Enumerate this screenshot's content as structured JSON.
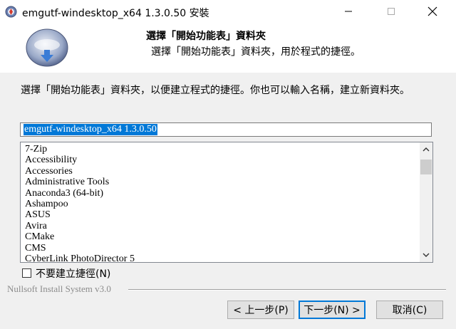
{
  "window": {
    "title": "emgutf-windesktop_x64 1.3.0.50 安裝",
    "controls": {
      "minimize": "—",
      "maximize": "☐",
      "close": "✕"
    }
  },
  "header": {
    "title": "選擇「開始功能表」資料夾",
    "subtitle": "選擇「開始功能表」資料夾，用於程式的捷徑。"
  },
  "instruction": "選擇「開始功能表」資料夾，以便建立程式的捷徑。你也可以輸入名稱，建立新資料夾。",
  "folder_input": {
    "value": "emgutf-windesktop_x64 1.3.0.50"
  },
  "folder_list": {
    "items": [
      "7-Zip",
      "Accessibility",
      "Accessories",
      "Administrative Tools",
      "Anaconda3 (64-bit)",
      "Ashampoo",
      "ASUS",
      "Avira",
      "CMake",
      "CMS",
      "CyberLink PhotoDirector 5"
    ]
  },
  "checkbox": {
    "label": "不要建立捷徑(N)",
    "checked": false
  },
  "branding": "Nullsoft Install System v3.0",
  "buttons": {
    "back": "< 上一步(P)",
    "next": "下一步(N) >",
    "cancel": "取消(C)"
  },
  "colors": {
    "accent": "#0078d7",
    "background": "#f0f0f0"
  }
}
